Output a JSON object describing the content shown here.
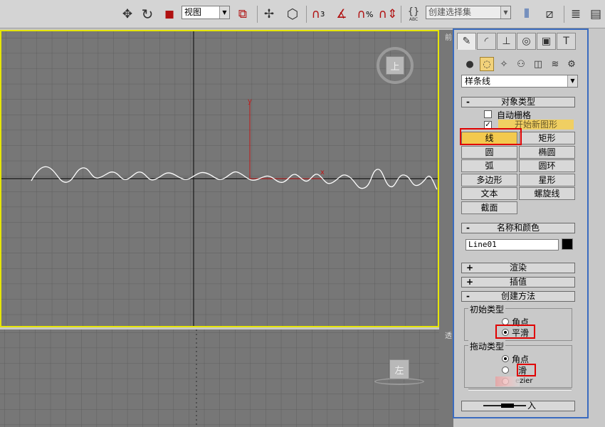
{
  "toolbar": {
    "view_dropdown": "视图",
    "selection_set_placeholder": "创建选择集",
    "snap_3_label": "3",
    "percent_snap_label": "%",
    "abc_label": "ABC",
    "icons": [
      "move-icon",
      "rotate-icon",
      "scale-icon",
      "mirror-icon",
      "align-icon",
      "snap-toggle-icon",
      "angle-snap-icon",
      "percent-snap-icon",
      "spinner-snap-icon",
      "named-selection-icon",
      "layer-manager-icon"
    ]
  },
  "viewport_top": {
    "name": "上",
    "axis_x": "x",
    "axis_y": "y",
    "border_color": "#e6e600"
  },
  "viewport_bottom": {
    "name": "左"
  },
  "viewport_right_labels": {
    "top": "前",
    "bottom": "透"
  },
  "panel": {
    "tabs": [
      "create-tab",
      "modify-tab",
      "hierarchy-tab",
      "motion-tab",
      "display-tab",
      "utilities-tab"
    ],
    "subcategories": [
      "geometry",
      "shapes",
      "lights",
      "cameras",
      "helpers",
      "space-warps",
      "systems"
    ],
    "category": "样条线",
    "object_type": {
      "title": "对象类型",
      "sign": "-",
      "auto_grid": "自动栅格",
      "start_new_shape": "开始新图形",
      "buttons": [
        "线",
        "矩形",
        "圆",
        "椭圆",
        "弧",
        "圆环",
        "多边形",
        "星形",
        "文本",
        "螺旋线",
        "截面"
      ]
    },
    "name_color": {
      "title": "名称和颜色",
      "sign": "-",
      "name_value": "Line01",
      "color": "#000000"
    },
    "render": {
      "title": "渲染",
      "sign": "+"
    },
    "interpolation": {
      "title": "插值",
      "sign": "+"
    },
    "creation_method": {
      "title": "创建方法",
      "sign": "-",
      "initial_type": {
        "label": "初始类型",
        "options": [
          "角点",
          "平滑"
        ],
        "selected": "平滑"
      },
      "drag_type": {
        "label": "拖动类型",
        "options": [
          "角点",
          "滑",
          "ezier"
        ],
        "selected": "角点"
      }
    },
    "bottom_partial": "入"
  },
  "highlight_color": "#e00000",
  "accent_color": "#3a6bbf"
}
